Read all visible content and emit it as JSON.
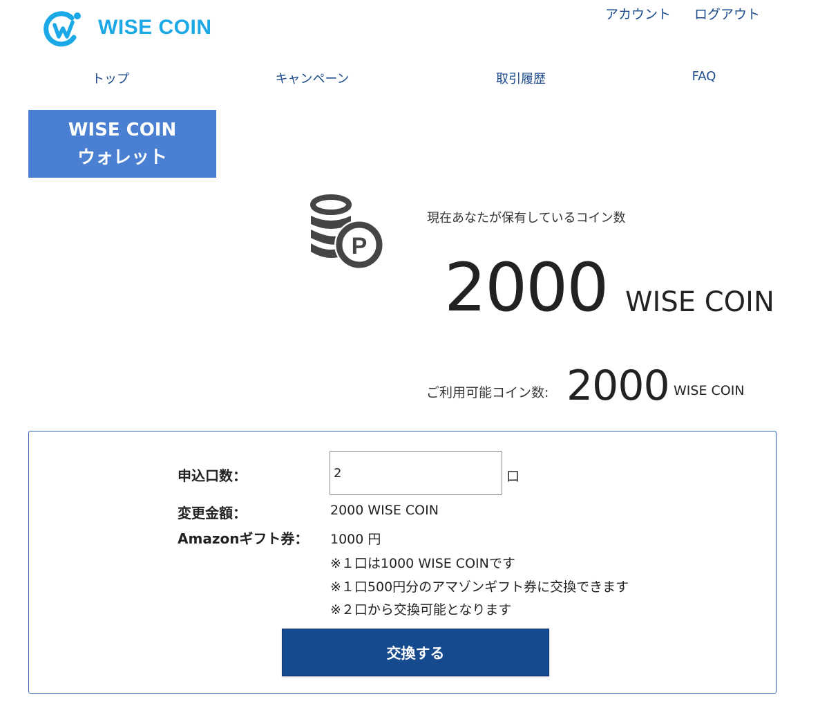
{
  "brand": {
    "name": "WISE COIN",
    "color": "#1ba8e6"
  },
  "header": {
    "account_link": "アカウント",
    "logout_link": "ログアウト"
  },
  "nav": {
    "items": [
      {
        "label": "トップ"
      },
      {
        "label": "キャンペーン"
      },
      {
        "label": "取引履歴"
      },
      {
        "label": "FAQ"
      }
    ]
  },
  "page_heading": {
    "line1": "WISE COIN",
    "line2": "ウォレット",
    "background": "#4a7fd1"
  },
  "balance": {
    "caption": "現在あなたが保有しているコイン数",
    "value": "2000",
    "unit": "WISE COIN",
    "icon": "coin-stack-p-icon"
  },
  "available": {
    "label": "ご利用可能コイン数:",
    "value": "2000",
    "unit": "WISE COIN"
  },
  "exchange_form": {
    "quantity_label": "申込口数：",
    "quantity_value": "2",
    "quantity_unit": "口",
    "amount_label": "変更金額：",
    "amount_value": "2000 WISE COIN",
    "gift_label": "Amazonギフト券：",
    "gift_value": "1000 円",
    "notes": [
      "※１口は1000 WISE COINです",
      "※１口500円分のアマゾンギフト券に交換できます",
      "※２口から交換可能となります"
    ],
    "submit_label": "交換する",
    "button_color": "#164a8f",
    "border_color": "#2f5fae"
  }
}
